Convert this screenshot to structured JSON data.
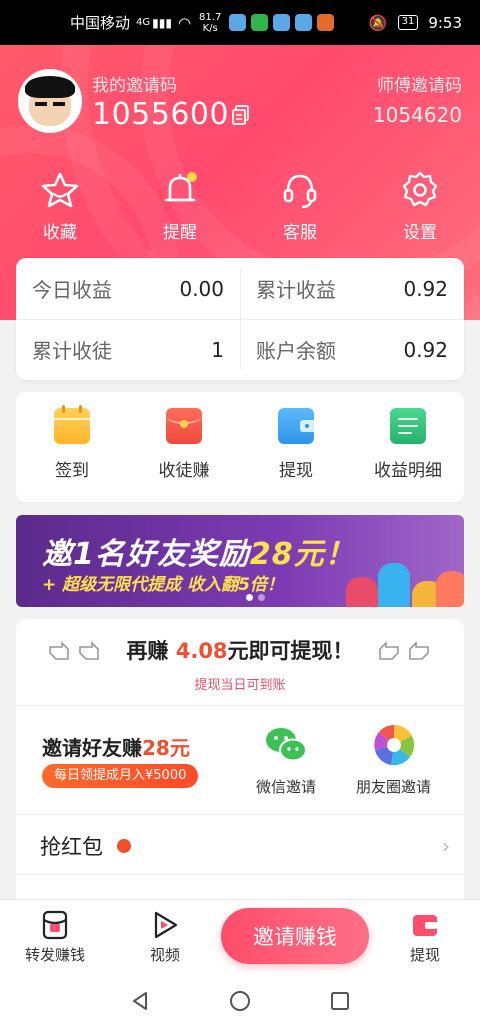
{
  "status_bar": {
    "carrier": "中国移动",
    "signal": "4G",
    "net_speed_value": "81.7",
    "net_speed_unit": "K/s",
    "battery": "31",
    "time": "9:53"
  },
  "profile": {
    "my_code_label": "我的邀请码",
    "my_code": "1055600",
    "master_label": "师傅邀请码",
    "master_code": "1054620"
  },
  "quick_actions": [
    {
      "label": "收藏",
      "icon": "star-icon"
    },
    {
      "label": "提醒",
      "icon": "bell-icon"
    },
    {
      "label": "客服",
      "icon": "headset-icon"
    },
    {
      "label": "设置",
      "icon": "gear-icon"
    }
  ],
  "stats": [
    {
      "label": "今日收益",
      "value": "0.00"
    },
    {
      "label": "累计收益",
      "value": "0.92"
    },
    {
      "label": "累计收徒",
      "value": "1"
    },
    {
      "label": "账户余额",
      "value": "0.92"
    }
  ],
  "features": [
    {
      "label": "签到",
      "icon": "calendar-icon",
      "color": "#ffc23a"
    },
    {
      "label": "收徒赚",
      "icon": "red-envelope-icon",
      "color": "#f3584a"
    },
    {
      "label": "提现",
      "icon": "wallet-icon",
      "color": "#3fa9f5"
    },
    {
      "label": "收益明细",
      "icon": "scroll-icon",
      "color": "#35c27a"
    }
  ],
  "banner": {
    "line1_prefix": "邀1名好友奖励",
    "line1_amount": "28元！",
    "line2": "+ 超级无限代提成 收入翻5倍！"
  },
  "earn": {
    "prefix": "再赚",
    "amount": "4.08",
    "suffix": "元即可提现！",
    "subtitle": "提现当日可到账",
    "invite_prefix": "邀请好友赚",
    "invite_amount": "28元",
    "pill": "每日领提成月入¥5000",
    "wechat_label": "微信邀请",
    "moments_label": "朋友圈邀请",
    "row1": "抢红包"
  },
  "tabbar": {
    "tab1": "转发赚钱",
    "tab2": "视频",
    "invite": "邀请赚钱",
    "tab4": "提现"
  },
  "colors": {
    "brand_red": "#ff4a6e",
    "accent_orange": "#f05030"
  }
}
